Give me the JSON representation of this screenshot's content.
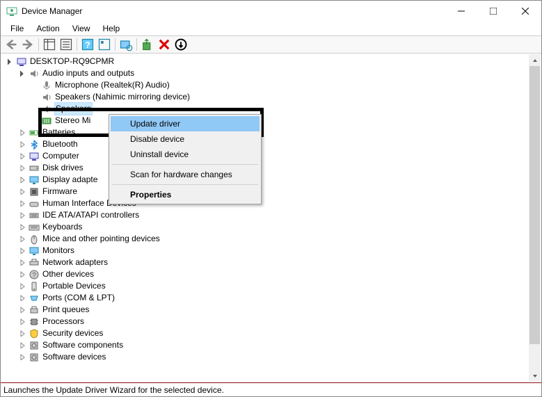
{
  "window": {
    "title": "Device Manager"
  },
  "menubar": [
    "File",
    "Action",
    "View",
    "Help"
  ],
  "tree": {
    "root": "DESKTOP-RQ9CPMR",
    "audio_category": "Audio inputs and outputs",
    "audio_children": [
      "Microphone (Realtek(R) Audio)",
      "Speakers (Nahimic mirroring device)",
      "Speakers",
      "Stereo Mi"
    ],
    "categories": [
      "Batteries",
      "Bluetooth",
      "Computer",
      "Disk drives",
      "Display adapte",
      "Firmware",
      "Human Interface Devices",
      "IDE ATA/ATAPI controllers",
      "Keyboards",
      "Mice and other pointing devices",
      "Monitors",
      "Network adapters",
      "Other devices",
      "Portable Devices",
      "Ports (COM & LPT)",
      "Print queues",
      "Processors",
      "Security devices",
      "Software components",
      "Software devices"
    ]
  },
  "contextmenu": {
    "items": [
      "Update driver",
      "Disable device",
      "Uninstall device",
      "Scan for hardware changes",
      "Properties"
    ]
  },
  "statusbar": "Launches the Update Driver Wizard for the selected device."
}
